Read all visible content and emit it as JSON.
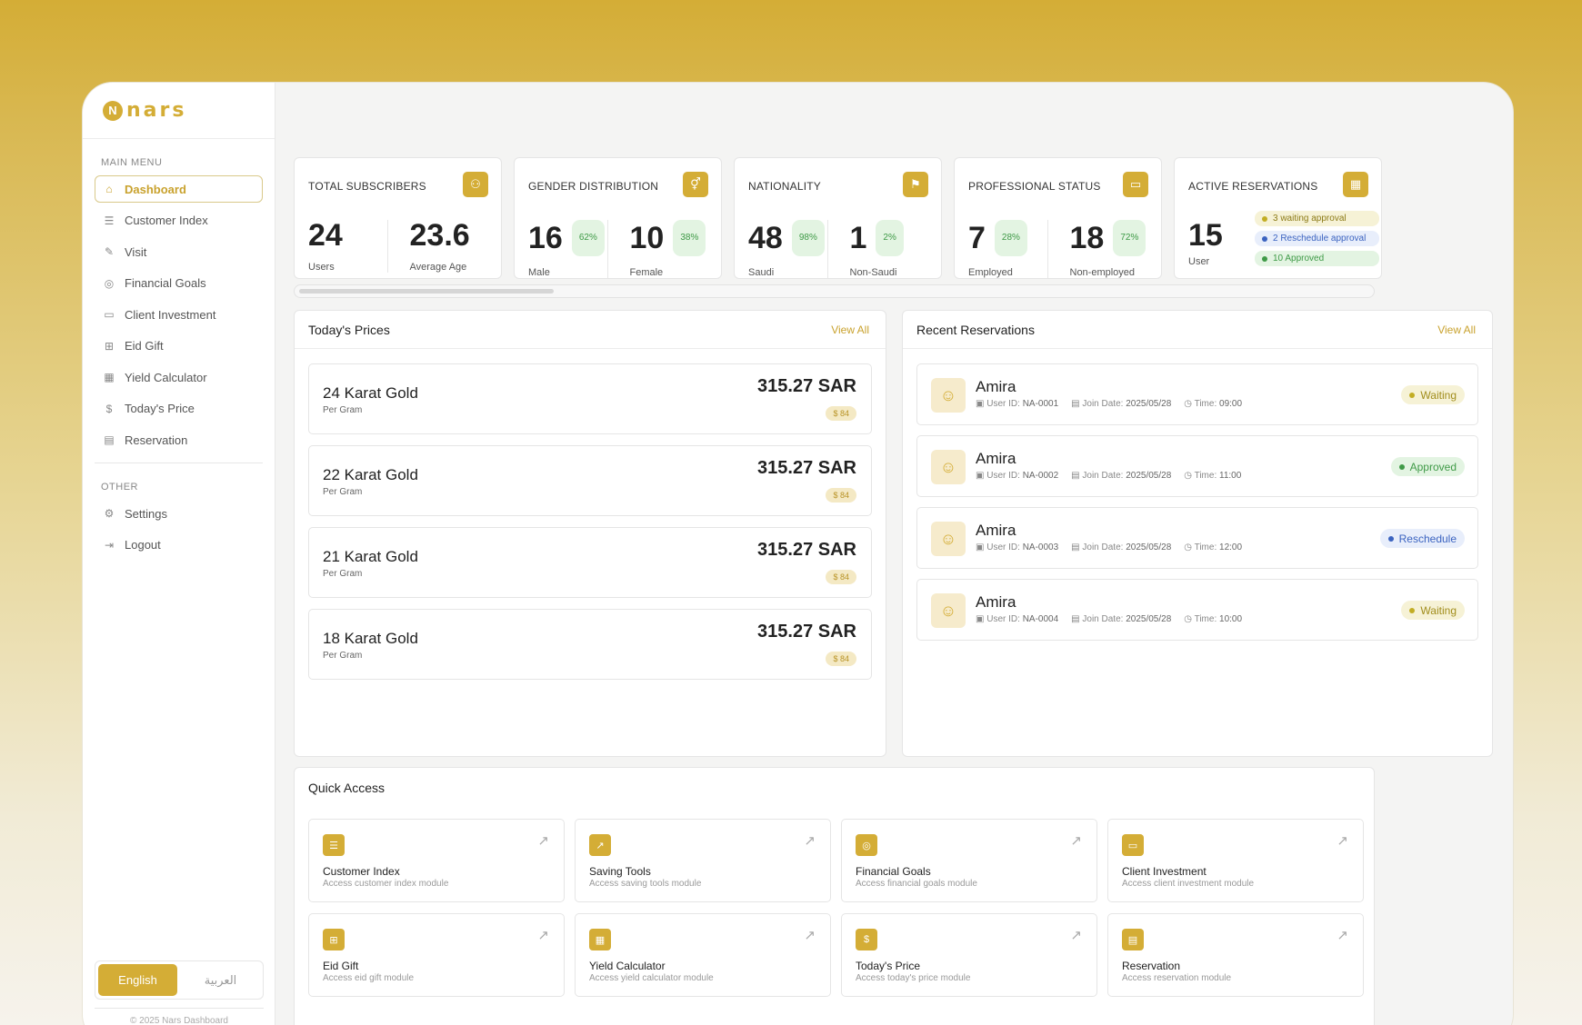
{
  "brand": {
    "name": "nars",
    "mark": "N"
  },
  "sidebar": {
    "main_menu_label": "MAIN MENU",
    "items": [
      {
        "label": "Dashboard",
        "icon": "home-icon"
      },
      {
        "label": "Customer Index",
        "icon": "users-list-icon"
      },
      {
        "label": "Visit",
        "icon": "edit-icon"
      },
      {
        "label": "Financial Goals",
        "icon": "target-icon"
      },
      {
        "label": "Client Investment",
        "icon": "briefcase-icon"
      },
      {
        "label": "Eid Gift",
        "icon": "gift-icon"
      },
      {
        "label": "Yield Calculator",
        "icon": "calculator-icon"
      },
      {
        "label": "Today's Price",
        "icon": "dollar-icon"
      },
      {
        "label": "Reservation",
        "icon": "calendar-icon"
      }
    ],
    "other_label": "OTHER",
    "other_items": [
      {
        "label": "Settings",
        "icon": "gear-icon"
      },
      {
        "label": "Logout",
        "icon": "logout-icon"
      }
    ],
    "lang": {
      "english": "English",
      "arabic": "العربية"
    },
    "copyright": "© 2025 Nars Dashboard"
  },
  "stats": {
    "subscribers": {
      "title": "TOTAL SUBSCRIBERS",
      "users": "24",
      "users_label": "Users",
      "age": "23.6",
      "age_label": "Average Age"
    },
    "gender": {
      "title": "GENDER DISTRIBUTION",
      "male": "16",
      "male_pct": "62%",
      "male_label": "Male",
      "female": "10",
      "female_pct": "38%",
      "female_label": "Female"
    },
    "nationality": {
      "title": "NATIONALITY",
      "saudi": "48",
      "saudi_pct": "98%",
      "saudi_label": "Saudi",
      "non": "1",
      "non_pct": "2%",
      "non_label": "Non-Saudi"
    },
    "professional": {
      "title": "PROFESSIONAL STATUS",
      "emp": "7",
      "emp_pct": "28%",
      "emp_label": "Employed",
      "non": "18",
      "non_pct": "72%",
      "non_label": "Non-employed"
    },
    "reservations": {
      "title": "ACTIVE RESERVATIONS",
      "count": "15",
      "label": "User",
      "waiting": "3 waiting approval",
      "reschedule": "2 Reschedule approval",
      "approved": "10 Approved"
    }
  },
  "prices": {
    "title": "Today's Prices",
    "view_all": "View All",
    "items": [
      {
        "name": "24 Karat Gold",
        "unit": "Per Gram",
        "value": "315.27 SAR",
        "usd": "$ 84"
      },
      {
        "name": "22 Karat Gold",
        "unit": "Per Gram",
        "value": "315.27 SAR",
        "usd": "$ 84"
      },
      {
        "name": "21 Karat Gold",
        "unit": "Per Gram",
        "value": "315.27 SAR",
        "usd": "$ 84"
      },
      {
        "name": "18 Karat Gold",
        "unit": "Per Gram",
        "value": "315.27 SAR",
        "usd": "$ 84"
      }
    ]
  },
  "recent": {
    "title": "Recent Reservations",
    "view_all": "View All",
    "labels": {
      "user_id": "User ID:",
      "join": "Join Date:",
      "time": "Time:"
    },
    "items": [
      {
        "name": "Amira",
        "user_id": "NA-0001",
        "join": "2025/05/28",
        "time": "09:00",
        "status": "Waiting"
      },
      {
        "name": "Amira",
        "user_id": "NA-0002",
        "join": "2025/05/28",
        "time": "11:00",
        "status": "Approved"
      },
      {
        "name": "Amira",
        "user_id": "NA-0003",
        "join": "2025/05/28",
        "time": "12:00",
        "status": "Reschedule"
      },
      {
        "name": "Amira",
        "user_id": "NA-0004",
        "join": "2025/05/28",
        "time": "10:00",
        "status": "Waiting"
      }
    ]
  },
  "quick": {
    "title": "Quick Access",
    "items": [
      {
        "name": "Customer Index",
        "desc": "Access customer index module"
      },
      {
        "name": "Saving Tools",
        "desc": "Access saving tools module"
      },
      {
        "name": "Financial Goals",
        "desc": "Access financial goals module"
      },
      {
        "name": "Client Investment",
        "desc": "Access client investment module"
      },
      {
        "name": "Eid Gift",
        "desc": "Access eid gift module"
      },
      {
        "name": "Yield Calculator",
        "desc": "Access yield calculator module"
      },
      {
        "name": "Today's Price",
        "desc": "Access today's price module"
      },
      {
        "name": "Reservation",
        "desc": "Access reservation module"
      }
    ]
  },
  "colors": {
    "accent": "#d4ad36",
    "approved": "#3f9a47",
    "reschedule": "#3b63c0",
    "waiting": "#c2ad24"
  }
}
